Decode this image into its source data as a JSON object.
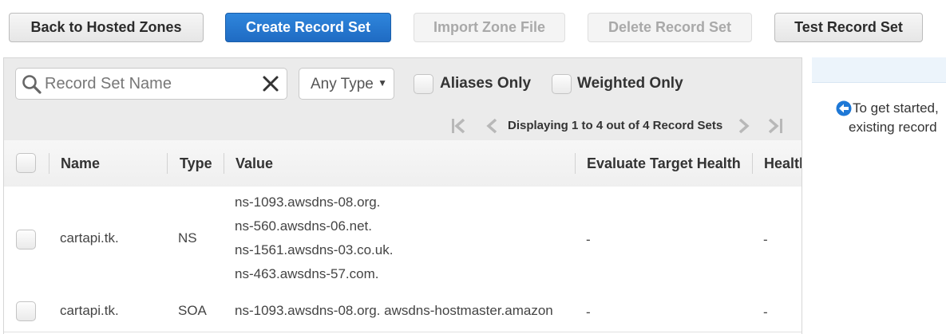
{
  "toolbar": {
    "back_label": "Back to Hosted Zones",
    "create_label": "Create Record Set",
    "import_label": "Import Zone File",
    "delete_label": "Delete Record Set",
    "test_label": "Test Record Set"
  },
  "filters": {
    "search_placeholder": "Record Set Name",
    "type_value": "Any Type",
    "aliases_label": "Aliases Only",
    "weighted_label": "Weighted Only"
  },
  "pagination": {
    "text": "Displaying 1 to 4 out of 4 Record Sets"
  },
  "table": {
    "headers": {
      "name": "Name",
      "type": "Type",
      "value": "Value",
      "evaluate": "Evaluate Target Health",
      "health": "Health"
    },
    "rows": [
      {
        "name": "cartapi.tk.",
        "type": "NS",
        "values": [
          "ns-1093.awsdns-08.org.",
          "ns-560.awsdns-06.net.",
          "ns-1561.awsdns-03.co.uk.",
          "ns-463.awsdns-57.com."
        ],
        "evaluate": "-",
        "health": "-"
      },
      {
        "name": "cartapi.tk.",
        "type": "SOA",
        "values": [
          "ns-1093.awsdns-08.org. awsdns-hostmaster.amazon"
        ],
        "evaluate": "-",
        "health": "-"
      }
    ]
  },
  "side_panel": {
    "line1": "To get started,",
    "line2": "existing record"
  },
  "colors": {
    "primary": "#1f6bc3",
    "info_icon": "#1e78d6"
  }
}
